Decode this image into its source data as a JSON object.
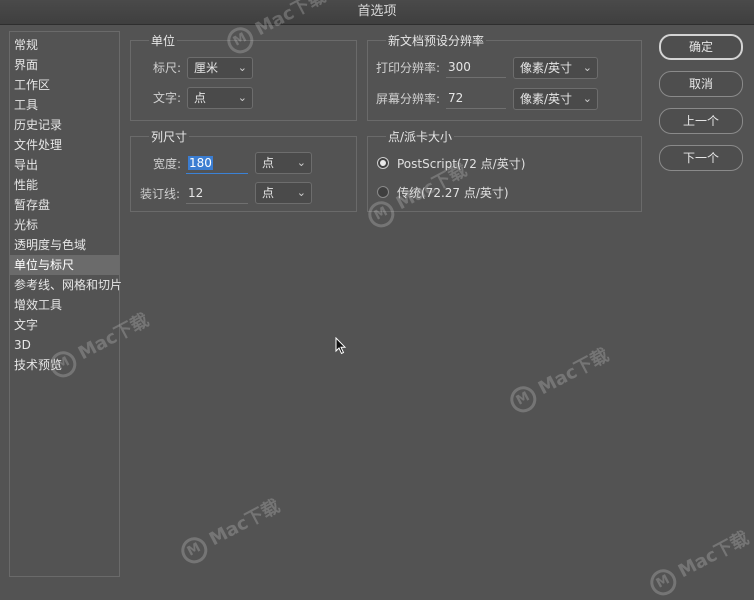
{
  "window": {
    "title": "首选项"
  },
  "sidebar": {
    "items": [
      {
        "label": "常规"
      },
      {
        "label": "界面"
      },
      {
        "label": "工作区"
      },
      {
        "label": "工具"
      },
      {
        "label": "历史记录"
      },
      {
        "label": "文件处理"
      },
      {
        "label": "导出"
      },
      {
        "label": "性能"
      },
      {
        "label": "暂存盘"
      },
      {
        "label": "光标"
      },
      {
        "label": "透明度与色域"
      },
      {
        "label": "单位与标尺",
        "selected": true
      },
      {
        "label": "参考线、网格和切片"
      },
      {
        "label": "增效工具"
      },
      {
        "label": "文字"
      },
      {
        "label": "3D"
      },
      {
        "label": "技术预览"
      }
    ]
  },
  "units": {
    "title": "单位",
    "ruler_label": "标尺:",
    "ruler_value": "厘米",
    "type_label": "文字:",
    "type_value": "点"
  },
  "resolution": {
    "title": "新文档预设分辨率",
    "print_label": "打印分辨率:",
    "print_value": "300",
    "print_unit": "像素/英寸",
    "screen_label": "屏幕分辨率:",
    "screen_value": "72",
    "screen_unit": "像素/英寸"
  },
  "column": {
    "title": "列尺寸",
    "width_label": "宽度:",
    "width_value": "180",
    "width_unit": "点",
    "gutter_label": "装订线:",
    "gutter_value": "12",
    "gutter_unit": "点"
  },
  "point_size": {
    "title": "点/派卡大小",
    "option_postscript": "PostScript(72 点/英寸)",
    "option_traditional": "传统(72.27 点/英寸)",
    "selected": "postscript"
  },
  "buttons": {
    "ok": "确定",
    "cancel": "取消",
    "prev": "上一个",
    "next": "下一个"
  },
  "watermark": {
    "logo_letter": "M",
    "text": "Mac下载"
  }
}
